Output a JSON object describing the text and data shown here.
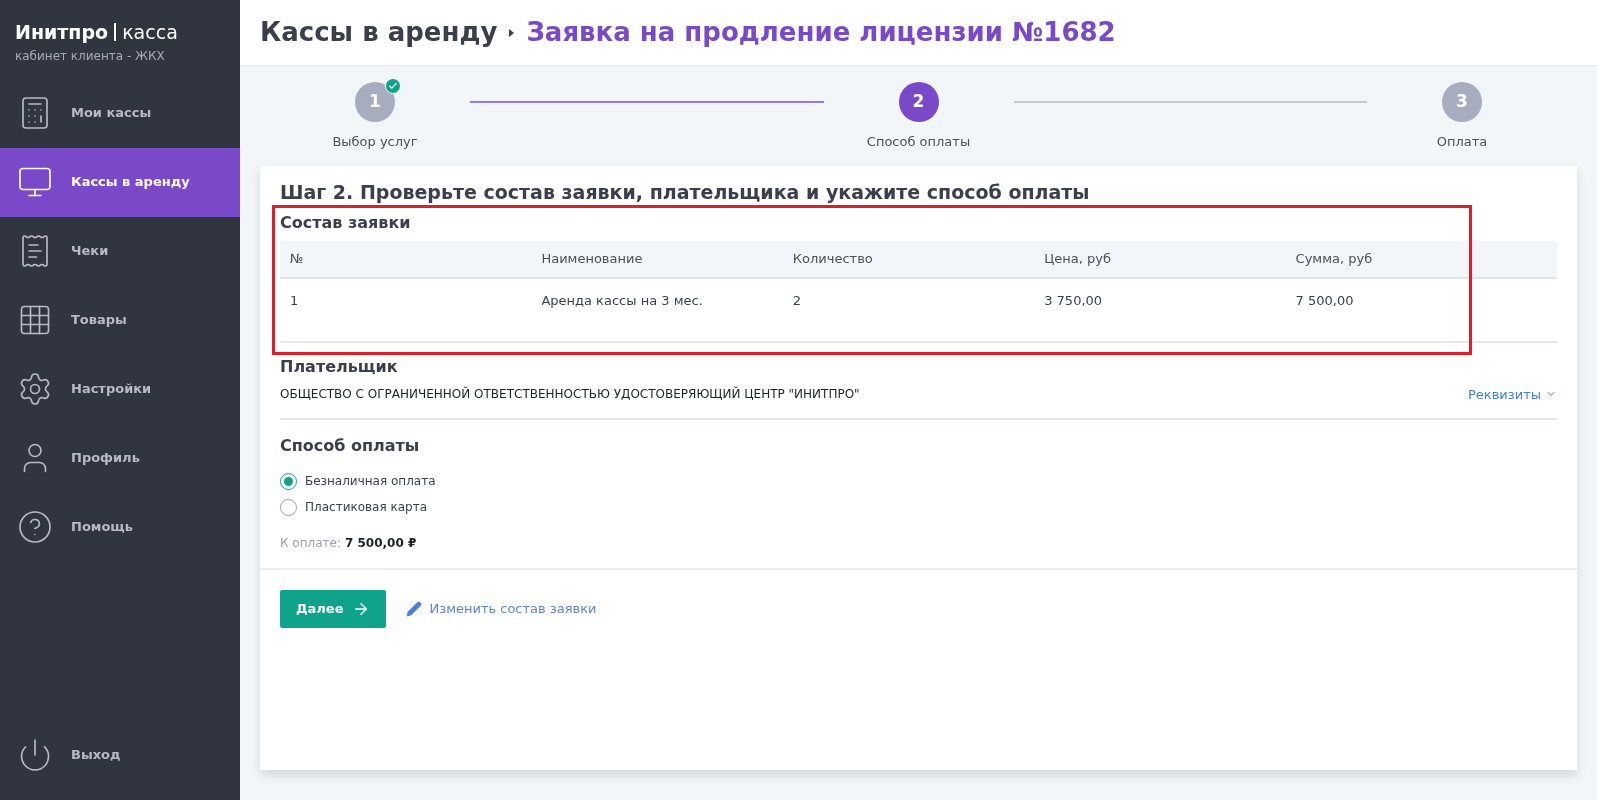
{
  "brand": {
    "name": "Инитпро",
    "product": "касса",
    "subtitle": "кабинет клиента - ЖКХ"
  },
  "sidebar": {
    "items": [
      {
        "label": "Мои кассы",
        "selected": false
      },
      {
        "label": "Кассы в аренду",
        "selected": true
      },
      {
        "label": "Чеки",
        "selected": false
      },
      {
        "label": "Товары",
        "selected": false
      },
      {
        "label": "Настройки",
        "selected": false
      },
      {
        "label": "Профиль",
        "selected": false
      },
      {
        "label": "Помощь",
        "selected": false
      }
    ],
    "logout": "Выход"
  },
  "breadcrumb": {
    "parent": "Кассы в аренду",
    "current": "Заявка на продление лицензии №1682"
  },
  "steps": [
    {
      "number": "1",
      "label": "Выбор услуг",
      "selected": false,
      "done": true
    },
    {
      "number": "2",
      "label": "Способ оплаты",
      "selected": true,
      "done": false
    },
    {
      "number": "3",
      "label": "Оплата",
      "selected": false,
      "done": false
    }
  ],
  "heading": "Шаг 2. Проверьте состав заявки, плательщика и укажите способ оплаты",
  "order": {
    "title": "Состав заявки",
    "highlighted": true,
    "columns": [
      "№",
      "Наименование",
      "Количество",
      "Цена, руб",
      "Сумма, руб"
    ],
    "rows": [
      [
        "1",
        "Аренда кассы на 3 мес.",
        "2",
        "3 750,00",
        "7 500,00"
      ]
    ]
  },
  "payer": {
    "title": "Плательщик",
    "name": "ОБЩЕСТВО С ОГРАНИЧЕННОЙ ОТВЕТСТВЕННОСТЬЮ УДОСТОВЕРЯЮЩИЙ ЦЕНТР \"ИНИТПРО\"",
    "details_link": "Реквизиты",
    "expanded": false
  },
  "payment": {
    "title": "Способ оплаты",
    "options": [
      {
        "label": "Безналичная оплата",
        "selected": true
      },
      {
        "label": "Пластиковая карта",
        "selected": false
      }
    ],
    "total_label": "К оплате:",
    "total": "7 500,00 ₽"
  },
  "actions": {
    "next": "Далее",
    "edit": "Изменить состав заявки"
  }
}
